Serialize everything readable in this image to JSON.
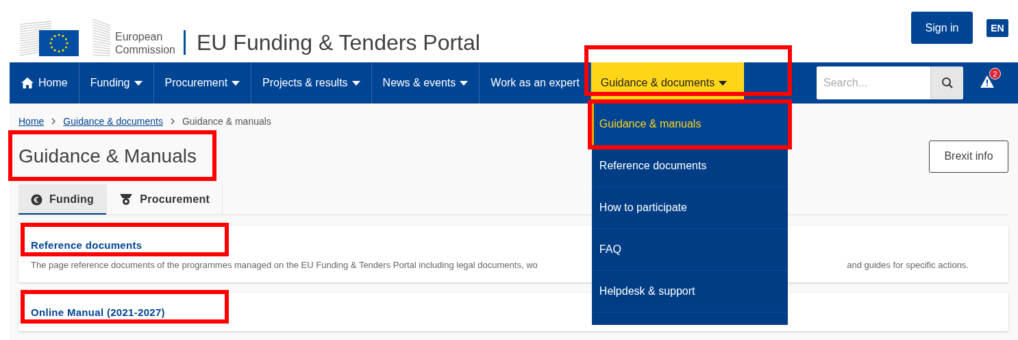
{
  "header": {
    "logo_lines": [
      "European",
      "Commission"
    ],
    "title": "EU Funding & Tenders Portal",
    "sign_in": "Sign in",
    "language": "EN"
  },
  "nav": {
    "items": [
      {
        "label": "Home",
        "kind": "home",
        "selected": false,
        "highlighted": false
      },
      {
        "label": "Funding",
        "kind": "menu",
        "selected": false,
        "highlighted": false
      },
      {
        "label": "Procurement",
        "kind": "menu",
        "selected": false,
        "highlighted": false
      },
      {
        "label": "Projects & results",
        "kind": "menu",
        "selected": false,
        "highlighted": false
      },
      {
        "label": "News & events",
        "kind": "menu",
        "selected": false,
        "highlighted": false
      },
      {
        "label": "Work as an expert",
        "kind": "link",
        "selected": false,
        "highlighted": false
      },
      {
        "label": "Guidance & documents",
        "kind": "menu",
        "selected": true,
        "highlighted": true
      }
    ],
    "search": {
      "placeholder": "Search..."
    },
    "alert_count": "2"
  },
  "dropdown": {
    "items": [
      {
        "label": "Guidance & manuals",
        "selected": true,
        "highlighted": true
      },
      {
        "label": "Reference documents",
        "selected": false,
        "highlighted": false
      },
      {
        "label": "How to participate",
        "selected": false,
        "highlighted": false
      },
      {
        "label": "FAQ",
        "selected": false,
        "highlighted": false
      },
      {
        "label": "Helpdesk & support",
        "selected": false,
        "highlighted": false
      }
    ]
  },
  "breadcrumb": [
    {
      "label": "Home",
      "kind": "link"
    },
    {
      "label": "Guidance & documents",
      "kind": "link"
    },
    {
      "label": "Guidance & manuals",
      "kind": "current"
    }
  ],
  "page": {
    "title": "Guidance & Manuals",
    "title_highlighted": true,
    "brexit_button": "Brexit info"
  },
  "tabs": [
    {
      "label": "Funding",
      "kind": "euro",
      "selected": true
    },
    {
      "label": "Procurement",
      "kind": "stamp",
      "selected": false
    }
  ],
  "cards": [
    {
      "title": "Reference documents",
      "highlighted": true,
      "description_visible": [
        "The page reference documents of the programmes managed on the EU Funding & Tenders Portal including legal documents, wo",
        "and guides for specific actions."
      ]
    },
    {
      "title": "Online Manual (2021-2027)",
      "highlighted": true
    }
  ]
}
